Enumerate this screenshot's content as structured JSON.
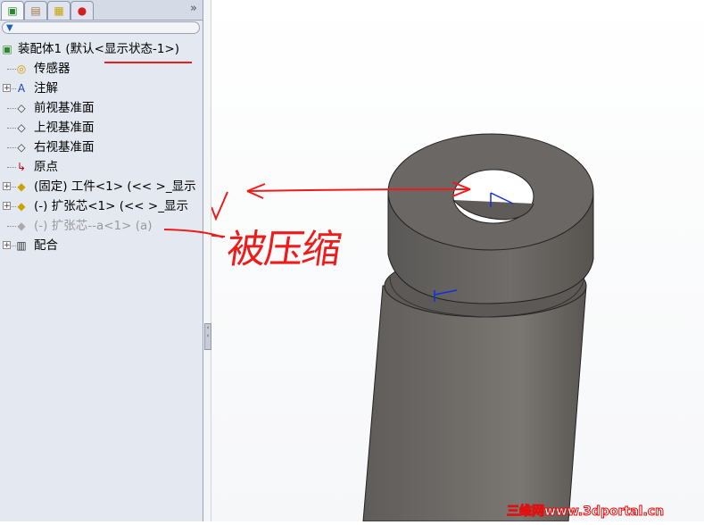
{
  "tabs": [
    {
      "name": "feature-manager",
      "icon": "assembly-icon"
    },
    {
      "name": "property-manager",
      "icon": "property-icon"
    },
    {
      "name": "configuration-manager",
      "icon": "configuration-icon"
    },
    {
      "name": "display-manager",
      "icon": "appearance-icon"
    }
  ],
  "more": "»",
  "filter": "▼",
  "tree": [
    {
      "label": "装配体1  (默认<显示状态-1>)",
      "icon": "assembly-icon",
      "expander": false,
      "dim": false
    },
    {
      "label": "传感器",
      "icon": "sensor-folder-icon",
      "expander": false,
      "dim": false
    },
    {
      "label": "注解",
      "icon": "annotation-folder-icon",
      "expander": true,
      "dim": false
    },
    {
      "label": "前视基准面",
      "icon": "plane-icon",
      "expander": false,
      "dim": false
    },
    {
      "label": "上视基准面",
      "icon": "plane-icon",
      "expander": false,
      "dim": false
    },
    {
      "label": "右视基准面",
      "icon": "plane-icon",
      "expander": false,
      "dim": false
    },
    {
      "label": "原点",
      "icon": "origin-icon",
      "expander": false,
      "dim": false
    },
    {
      "label": "(固定) 工件<1> (<<    >_显示",
      "icon": "part-icon",
      "expander": true,
      "dim": false
    },
    {
      "label": "(-) 扩张芯<1> (<<    >_显示",
      "icon": "part-icon",
      "expander": true,
      "dim": false
    },
    {
      "label": "(-) 扩张芯--a<1> (a)",
      "icon": "part-suppressed-icon",
      "expander": false,
      "dim": true
    },
    {
      "label": "配合",
      "icon": "mates-icon",
      "expander": true,
      "dim": false
    }
  ],
  "annotation": "被压缩",
  "watermark": "三维网www.3dportal.cn",
  "colors": {
    "annotation": "#ee1b1b",
    "part": "#6b6865"
  }
}
